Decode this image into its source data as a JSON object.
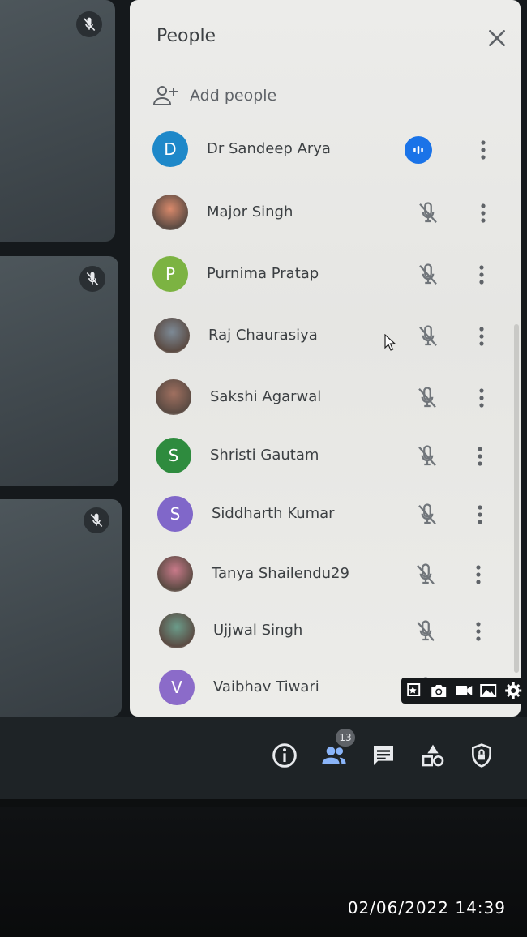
{
  "panel": {
    "title": "People",
    "add_people_label": "Add people"
  },
  "participants": [
    {
      "name": "Dr Sandeep Arya",
      "initial": "D",
      "avatar_color": "#1e88c9",
      "status": "speaking"
    },
    {
      "name": "Major Singh",
      "initial": "",
      "avatar_color": "#d9896b",
      "status": "muted"
    },
    {
      "name": "Purnima Pratap",
      "initial": "P",
      "avatar_color": "#7cb342",
      "status": "muted"
    },
    {
      "name": "Raj Chaurasiya",
      "initial": "",
      "avatar_color": "#7d8a96",
      "status": "muted"
    },
    {
      "name": "Sakshi Agarwal",
      "initial": "",
      "avatar_color": "#a07060",
      "status": "muted"
    },
    {
      "name": "Shristi Gautam",
      "initial": "S",
      "avatar_color": "#2e8b3e",
      "status": "muted"
    },
    {
      "name": "Siddharth Kumar",
      "initial": "S",
      "avatar_color": "#8067c9",
      "status": "muted"
    },
    {
      "name": "Tanya Shailendu29",
      "initial": "",
      "avatar_color": "#c97a8a",
      "status": "muted"
    },
    {
      "name": "Ujjwal Singh",
      "initial": "",
      "avatar_color": "#6b9c8a",
      "status": "muted"
    },
    {
      "name": "Vaibhav Tiwari",
      "initial": "V",
      "avatar_color": "#8b6bc9",
      "status": "muted"
    }
  ],
  "bottom_bar": {
    "people_count": "13"
  },
  "timestamp": "02/06/2022 14:39",
  "colors": {
    "accent": "#1a73e8",
    "panel_bg": "#ececea",
    "bar_bg": "#1e2326"
  }
}
